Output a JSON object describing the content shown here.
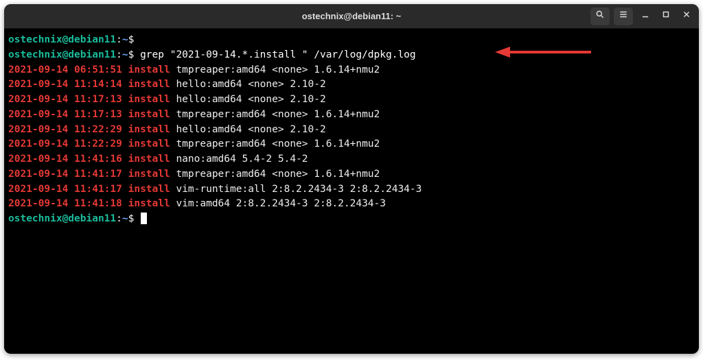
{
  "window": {
    "title": "ostechnix@debian11: ~"
  },
  "prompt": {
    "user_host": "ostechnix@debian11",
    "path": "~",
    "symbol": "$"
  },
  "command": "grep \"2021-09-14.*.install \" /var/log/dpkg.log",
  "output_lines": [
    {
      "date": "2021-09-14",
      "time": "06:51:51",
      "action": "install",
      "rest": "tmpreaper:amd64 <none> 1.6.14+nmu2"
    },
    {
      "date": "2021-09-14",
      "time": "11:14:14",
      "action": "install",
      "rest": "hello:amd64 <none> 2.10-2"
    },
    {
      "date": "2021-09-14",
      "time": "11:17:13",
      "action": "install",
      "rest": "hello:amd64 <none> 2.10-2"
    },
    {
      "date": "2021-09-14",
      "time": "11:17:13",
      "action": "install",
      "rest": "tmpreaper:amd64 <none> 1.6.14+nmu2"
    },
    {
      "date": "2021-09-14",
      "time": "11:22:29",
      "action": "install",
      "rest": "hello:amd64 <none> 2.10-2"
    },
    {
      "date": "2021-09-14",
      "time": "11:22:29",
      "action": "install",
      "rest": "tmpreaper:amd64 <none> 1.6.14+nmu2"
    },
    {
      "date": "2021-09-14",
      "time": "11:41:16",
      "action": "install",
      "rest": "nano:amd64 5.4-2 5.4-2"
    },
    {
      "date": "2021-09-14",
      "time": "11:41:17",
      "action": "install",
      "rest": "tmpreaper:amd64 <none> 1.6.14+nmu2"
    },
    {
      "date": "2021-09-14",
      "time": "11:41:17",
      "action": "install",
      "rest": "vim-runtime:all 2:8.2.2434-3 2:8.2.2434-3"
    },
    {
      "date": "2021-09-14",
      "time": "11:41:18",
      "action": "install",
      "rest": "vim:amd64 2:8.2.2434-3 2:8.2.2434-3"
    }
  ],
  "colors": {
    "prompt_user": "#1abc9c",
    "prompt_path": "#6aa3f7",
    "log_highlight": "#e53935",
    "arrow": "#e53935",
    "bg": "#000"
  },
  "annotation": {
    "name": "command-highlight-arrow"
  }
}
